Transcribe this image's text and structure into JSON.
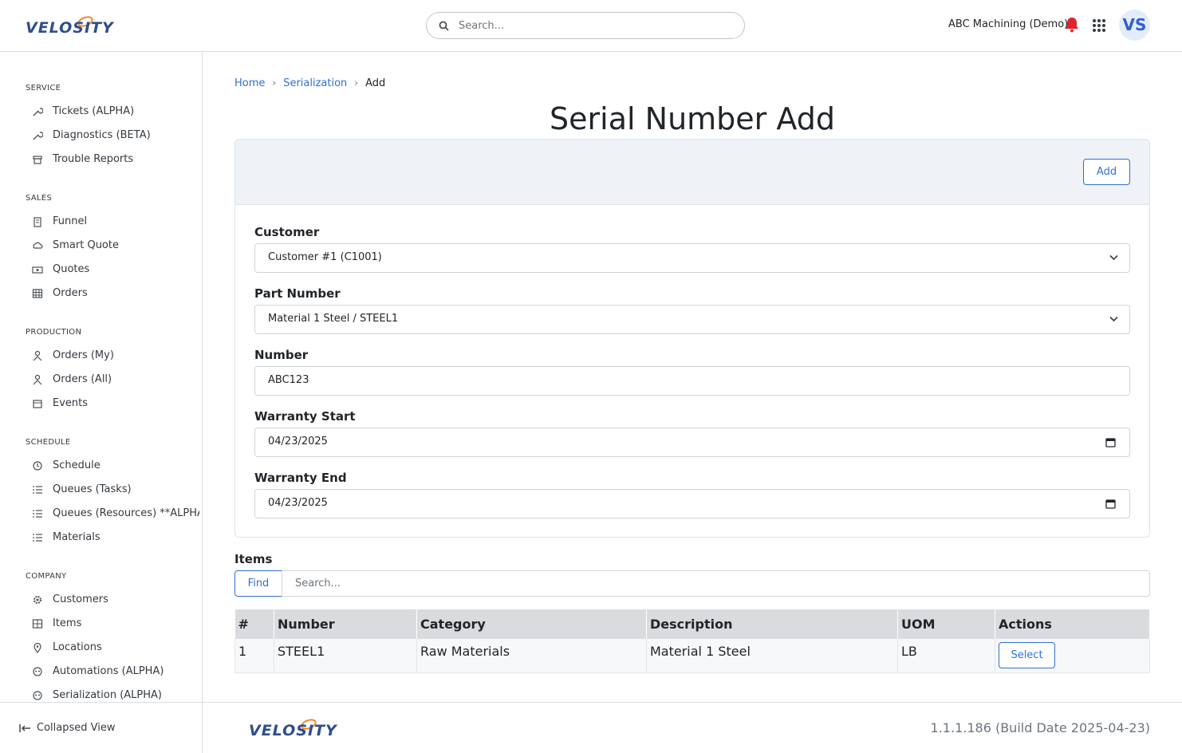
{
  "header": {
    "logo_text": "VELOSITY",
    "search_placeholder": "Search...",
    "company": "ABC Machining (Demo)",
    "avatar_initials": "VS"
  },
  "sidebar": {
    "sections": [
      {
        "title": "SERVICE",
        "items": [
          {
            "label": "Tickets (ALPHA)",
            "icon": "wrench-icon"
          },
          {
            "label": "Diagnostics (BETA)",
            "icon": "wrench-icon"
          },
          {
            "label": "Trouble Reports",
            "icon": "archive-icon"
          }
        ]
      },
      {
        "title": "SALES",
        "items": [
          {
            "label": "Funnel",
            "icon": "building-icon"
          },
          {
            "label": "Smart Quote",
            "icon": "cloud-icon"
          },
          {
            "label": "Quotes",
            "icon": "money-icon"
          },
          {
            "label": "Orders",
            "icon": "table-icon"
          }
        ]
      },
      {
        "title": "PRODUCTION",
        "items": [
          {
            "label": "Orders (My)",
            "icon": "person-icon"
          },
          {
            "label": "Orders (All)",
            "icon": "person-icon"
          },
          {
            "label": "Events",
            "icon": "calendar-icon"
          }
        ]
      },
      {
        "title": "SCHEDULE",
        "items": [
          {
            "label": "Schedule",
            "icon": "clock-icon"
          },
          {
            "label": "Queues (Tasks)",
            "icon": "list-icon"
          },
          {
            "label": "Queues (Resources) **ALPHA**",
            "icon": "list-icon"
          },
          {
            "label": "Materials",
            "icon": "list-icon"
          }
        ]
      },
      {
        "title": "COMPANY",
        "items": [
          {
            "label": "Customers",
            "icon": "gear-icon"
          },
          {
            "label": "Items",
            "icon": "grid-icon"
          },
          {
            "label": "Locations",
            "icon": "pin-icon"
          },
          {
            "label": "Automations (ALPHA)",
            "icon": "robot-icon"
          },
          {
            "label": "Serialization (ALPHA)",
            "icon": "robot-icon"
          }
        ]
      }
    ],
    "collapse_label": "Collapsed View"
  },
  "breadcrumb": {
    "home": "Home",
    "section": "Serialization",
    "current": "Add"
  },
  "page_title": "Serial Number Add",
  "form": {
    "add_label": "Add",
    "customer": {
      "label": "Customer",
      "value": "Customer #1 (C1001)"
    },
    "part_number": {
      "label": "Part Number",
      "value": "Material 1 Steel / STEEL1"
    },
    "number": {
      "label": "Number",
      "value": "ABC123"
    },
    "warranty_start": {
      "label": "Warranty Start",
      "value": "04/23/2025"
    },
    "warranty_end": {
      "label": "Warranty End",
      "value": "04/23/2025"
    }
  },
  "items": {
    "title": "Items",
    "find_label": "Find",
    "search_placeholder": "Search...",
    "columns": [
      "#",
      "Number",
      "Category",
      "Description",
      "UOM",
      "Actions"
    ],
    "rows": [
      {
        "idx": "1",
        "number": "STEEL1",
        "category": "Raw Materials",
        "description": "Material 1 Steel",
        "uom": "LB",
        "action": "Select"
      }
    ]
  },
  "footer": {
    "logo_text": "VELOSITY",
    "version": "1.1.1.186 (Build Date 2025-04-23)"
  },
  "colors": {
    "brand": "#2f4e8c",
    "accent": "#2f6fd6",
    "alert": "#e0242c"
  }
}
